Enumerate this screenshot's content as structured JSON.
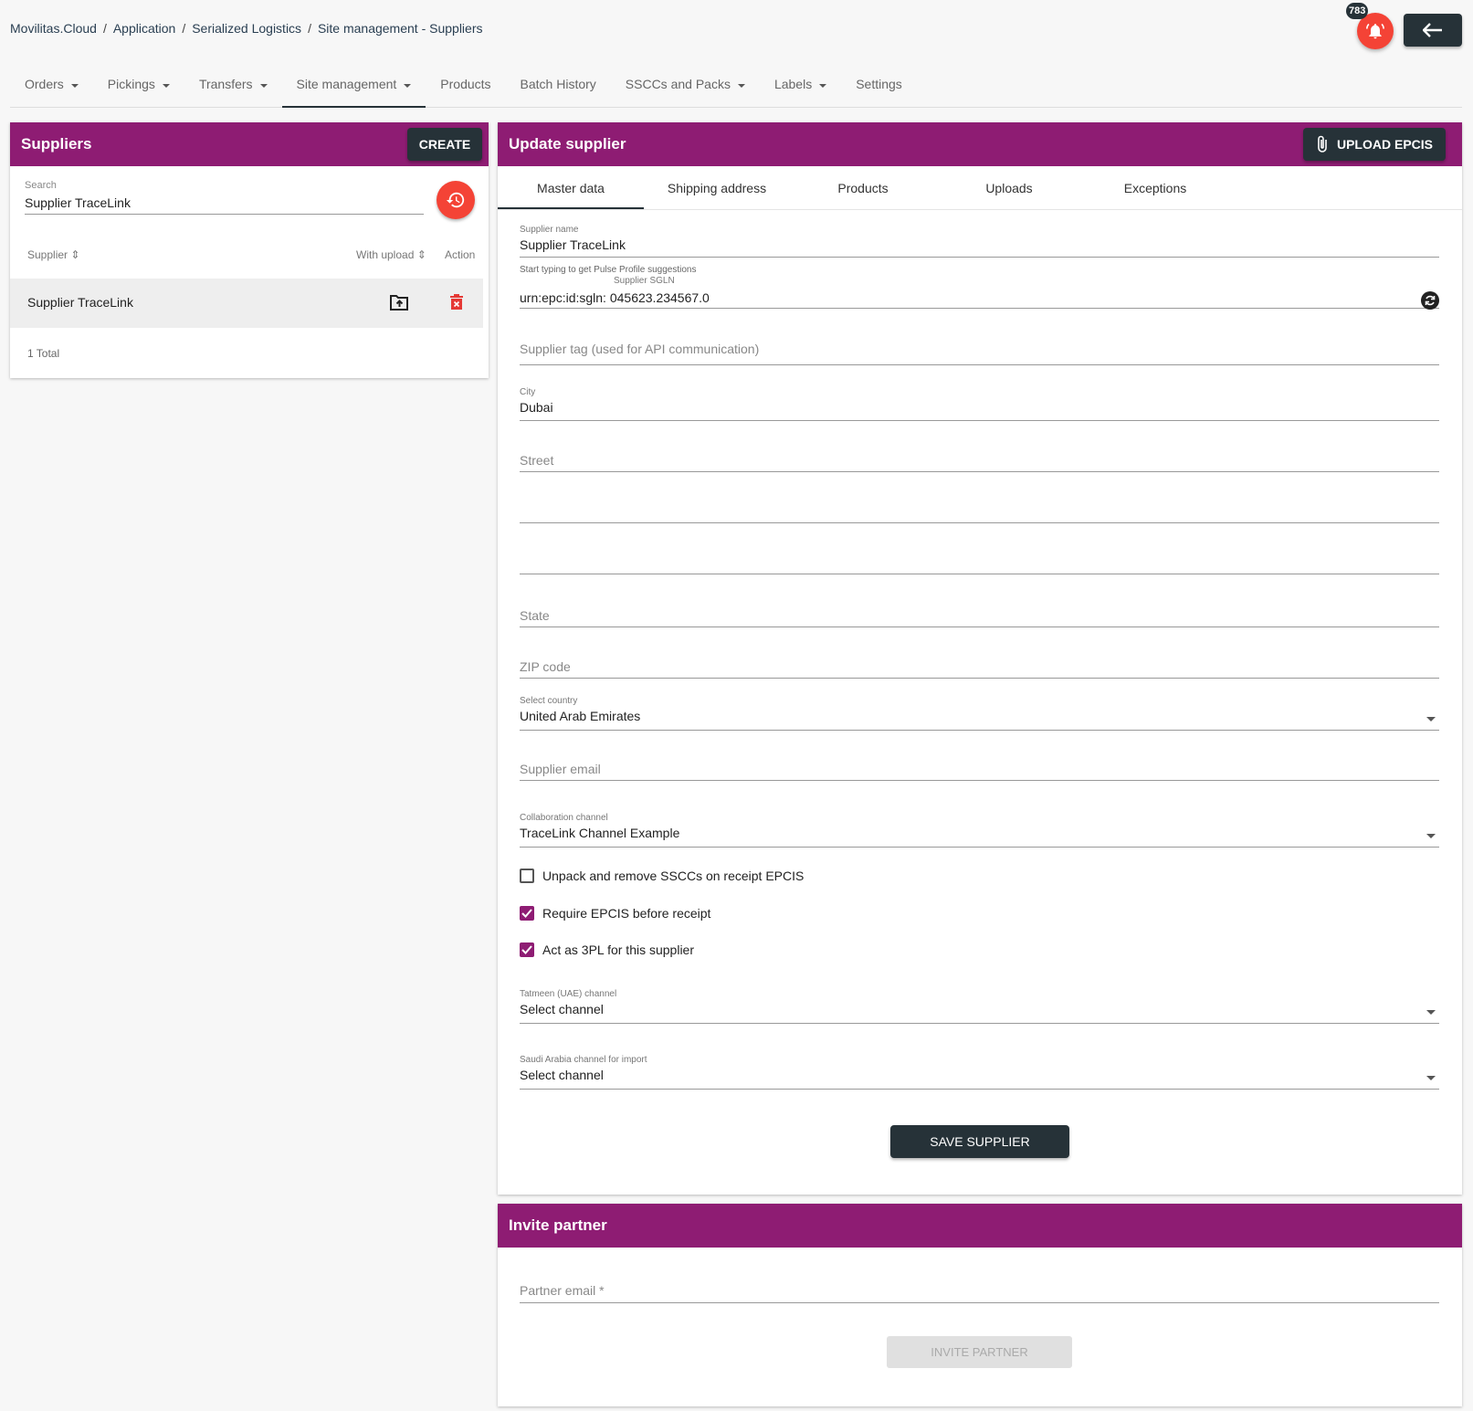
{
  "breadcrumb": [
    "Movilitas.Cloud",
    "Application",
    "Serialized Logistics",
    "Site management - Suppliers"
  ],
  "notifications": {
    "count": "783",
    "icon": "bell-icon"
  },
  "back_icon": "arrow-left-icon",
  "nav": [
    {
      "label": "Orders",
      "caret": true
    },
    {
      "label": "Pickings",
      "caret": true
    },
    {
      "label": "Transfers",
      "caret": true
    },
    {
      "label": "Site management",
      "caret": true,
      "active": true
    },
    {
      "label": "Products",
      "caret": false
    },
    {
      "label": "Batch History",
      "caret": false
    },
    {
      "label": "SSCCs and Packs",
      "caret": true
    },
    {
      "label": "Labels",
      "caret": true
    },
    {
      "label": "Settings",
      "caret": false
    }
  ],
  "suppliers_panel": {
    "title": "Suppliers",
    "create_label": "CREATE",
    "search_label": "Search",
    "search_value": "Supplier TraceLink",
    "columns": [
      "Supplier",
      "With upload",
      "Action"
    ],
    "rows": [
      {
        "name": "Supplier TraceLink"
      }
    ],
    "total": "1 Total"
  },
  "update_panel": {
    "title": "Update supplier",
    "upload_label": "UPLOAD EPCIS",
    "tabs": [
      "Master data",
      "Shipping address",
      "Products",
      "Uploads",
      "Exceptions"
    ],
    "supplier_name_label": "Supplier name",
    "supplier_name_value": "Supplier TraceLink",
    "hint": "Start typing to get Pulse Profile suggestions",
    "sgln_label": "Supplier SGLN",
    "sgln_value": "urn:epc:id:sgln: 045623.234567.0",
    "tag_placeholder": "Supplier tag (used for API communication)",
    "city_label": "City",
    "city_value": "Dubai",
    "street_placeholder": "Street",
    "state_placeholder": "State",
    "zip_placeholder": "ZIP code",
    "country_label": "Select country",
    "country_value": "United Arab Emirates",
    "email_placeholder": "Supplier email",
    "collab_label": "Collaboration channel",
    "collab_value": "TraceLink Channel Example",
    "checkboxes": [
      {
        "label": "Unpack and remove SSCCs on receipt EPCIS",
        "checked": false
      },
      {
        "label": "Require EPCIS before receipt",
        "checked": true
      },
      {
        "label": "Act as 3PL for this supplier",
        "checked": true
      }
    ],
    "tatmeen_label": "Tatmeen (UAE) channel",
    "tatmeen_value": "Select channel",
    "saudi_label": "Saudi Arabia channel for import",
    "saudi_value": "Select channel",
    "save_label": "SAVE SUPPLIER"
  },
  "invite_panel": {
    "title": "Invite partner",
    "email_placeholder": "Partner email *",
    "invite_label": "INVITE PARTNER"
  },
  "colors": {
    "header": "#8e1c73",
    "dark": "#263238",
    "accent": "#f44336"
  }
}
